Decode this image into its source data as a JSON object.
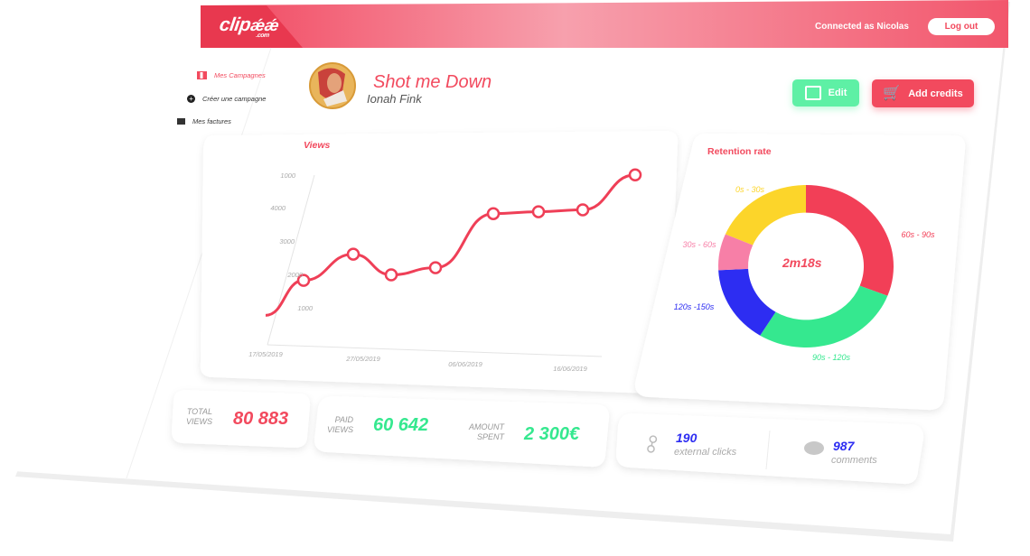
{
  "header": {
    "logo": "clip",
    "logo_suffix": ".com",
    "connected_as": "Connected as Nicolas",
    "logout_label": "Log out"
  },
  "sidebar": {
    "items": [
      {
        "label": "Mes Campagnes",
        "active": true
      },
      {
        "label": "Créer une campagne",
        "active": false
      },
      {
        "label": "Mes factures",
        "active": false
      }
    ]
  },
  "campaign": {
    "title": "Shot me Down",
    "artist": "Ionah Fink"
  },
  "actions": {
    "edit_label": "Edit",
    "add_credits_label": "Add credits"
  },
  "views_card": {
    "label": "Views"
  },
  "retention_card": {
    "label": "Retention rate",
    "center_value": "2m18s"
  },
  "stats": {
    "total_views_label_1": "TOTAL",
    "total_views_label_2": "VIEWS",
    "total_views_value": "80 883",
    "paid_views_label_1": "PAID",
    "paid_views_label_2": "VIEWS",
    "paid_views_value": "60 642",
    "amount_spent_label_1": "AMOUNT",
    "amount_spent_label_2": "SPENT",
    "amount_spent_value": "2 300€",
    "external_clicks_value": "190",
    "external_clicks_label": "external clicks",
    "comments_value": "987",
    "comments_label": "comments"
  },
  "colors": {
    "accent": "#f24a5e",
    "green": "#35e88f",
    "blue": "#2d2df2",
    "yellow": "#fcd52a",
    "pink": "#f77fa7"
  },
  "chart_data": [
    {
      "type": "line",
      "title": "Views",
      "y_ticks": [
        "1000",
        "2000",
        "3000",
        "4000",
        "1000"
      ],
      "x_ticks": [
        "17/05/2019",
        "27/05/2019",
        "06/06/2019",
        "16/06/2019"
      ],
      "series": [
        {
          "values": [
            900,
            1900,
            2650,
            2050,
            2250,
            3800,
            3850,
            3900,
            4900
          ]
        }
      ]
    },
    {
      "type": "pie",
      "title": "Retention rate",
      "slices": [
        {
          "label": "0s - 30s",
          "value": 18,
          "color": "#fcd52a"
        },
        {
          "label": "60s - 90s",
          "value": 30,
          "color": "#f23f57"
        },
        {
          "label": "90s - 120s",
          "value": 27,
          "color": "#35e88f"
        },
        {
          "label": "120s -150s",
          "value": 15,
          "color": "#2d2df2"
        },
        {
          "label": "30s - 60s",
          "value": 7,
          "color": "#f77fa7"
        }
      ]
    }
  ]
}
